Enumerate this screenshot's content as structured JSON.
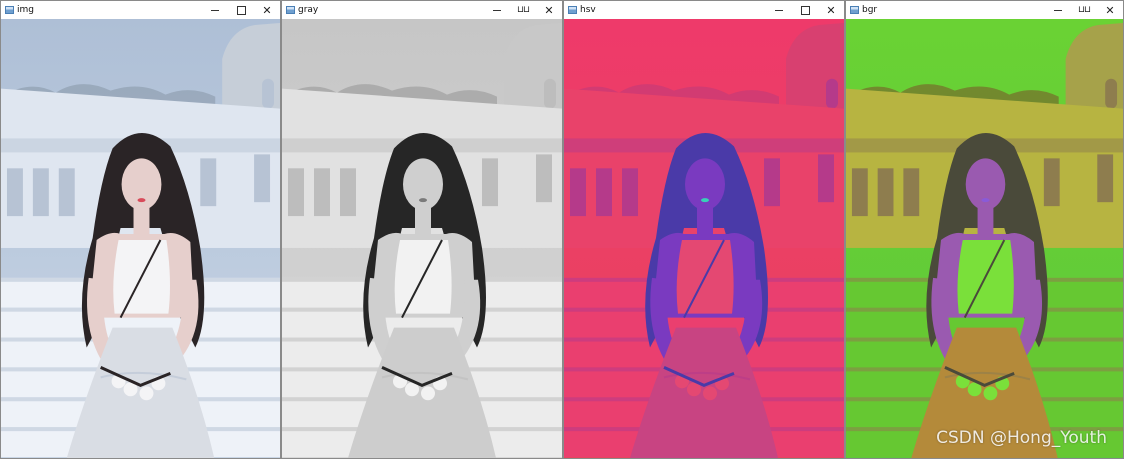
{
  "windows": [
    {
      "id": "img",
      "title": "img",
      "palette": {
        "sky": "#c9d6e6",
        "skyTop": "#aebfd6",
        "wall": "#dfe6f0",
        "wallShade": "#b7c3d4",
        "stairs": "#eef2f8",
        "hair": "#2a2426",
        "skin": "#e6cfcc",
        "top": "#f4f4f6",
        "skirt": "#d9dde4",
        "trees": "#8b99aa",
        "tower": "#c6ced8",
        "accent": "#d84b5a"
      }
    },
    {
      "id": "gray",
      "title": "gray",
      "palette": {
        "sky": "#d8d8d8",
        "skyTop": "#c6c6c6",
        "wall": "#e1e1e1",
        "wallShade": "#bdbdbd",
        "stairs": "#ececec",
        "hair": "#262626",
        "skin": "#cfcfcf",
        "top": "#f2f2f2",
        "skirt": "#cdcdcd",
        "trees": "#9a9a9a",
        "tower": "#c8c8c8",
        "accent": "#7a7a7a"
      }
    },
    {
      "id": "hsv",
      "title": "hsv",
      "palette": {
        "sky": "#e8455e",
        "skyTop": "#ee3a6a",
        "wall": "#e9426a",
        "wallShade": "#b53a8a",
        "stairs": "#ea3f6f",
        "hair": "#4a3aa8",
        "skin": "#7a3ac0",
        "top": "#e44872",
        "skirt": "#c84482",
        "trees": "#c03a7a",
        "tower": "#d84070",
        "accent": "#38d0b8"
      }
    },
    {
      "id": "bgr",
      "title": "bgr",
      "palette": {
        "sky": "#5ec83a",
        "skyTop": "#6ad234",
        "wall": "#b7b441",
        "wallShade": "#8e7d4e",
        "stairs": "#66c832",
        "hair": "#4a4a3a",
        "skin": "#9a5ab0",
        "top": "#7ae03a",
        "skirt": "#b48a3a",
        "trees": "#7a5a2a",
        "tower": "#a6a24a",
        "accent": "#8a5ad8"
      }
    }
  ],
  "watermark": "CSDN @Hong_Youth",
  "controls": {
    "minimize": "minimize",
    "maximize": "maximize",
    "restore": "restore",
    "close": "close"
  }
}
